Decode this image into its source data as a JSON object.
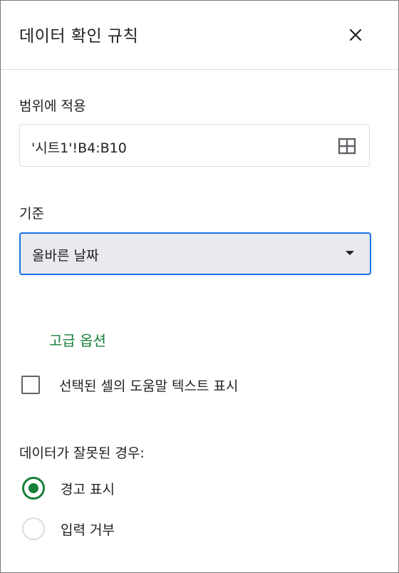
{
  "panel": {
    "title": "데이터 확인 규칙"
  },
  "range": {
    "label": "범위에 적용",
    "value": "'시트1'!B4:B10"
  },
  "criteria": {
    "label": "기준",
    "selected": "올바른 날짜"
  },
  "advanced": {
    "link_label": "고급 옵션",
    "help_checkbox_label": "선택된 셀의 도움말 텍스트 표시",
    "help_checkbox_checked": false
  },
  "invalid_data": {
    "label": "데이터가 잘못된 경우:",
    "options": [
      {
        "label": "경고 표시",
        "selected": true
      },
      {
        "label": "입력 거부",
        "selected": false
      }
    ]
  },
  "colors": {
    "accent_green": "#188038",
    "focus_blue": "#1a73e8"
  },
  "icons": {
    "close": "close-icon",
    "range_picker": "grid-icon",
    "dropdown": "caret-down-icon"
  }
}
